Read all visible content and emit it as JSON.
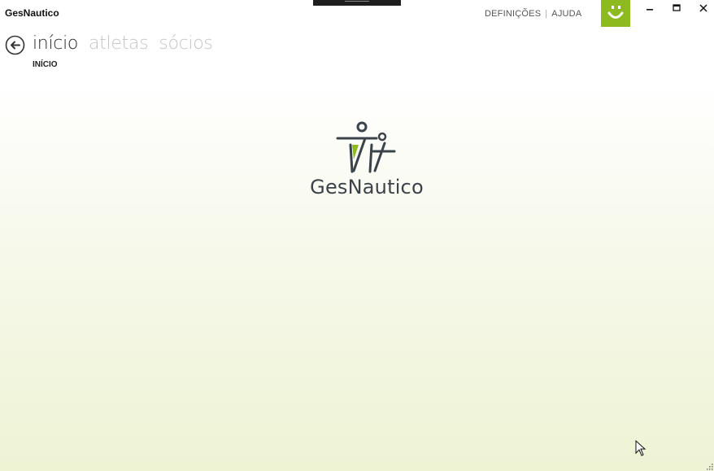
{
  "app": {
    "title": "GesNautico"
  },
  "header_links": {
    "settings": "DEFINIÇÕES",
    "separator": "|",
    "help": "AJUDA"
  },
  "navigation": {
    "tabs": [
      {
        "label": "início",
        "active": true
      },
      {
        "label": "atletas",
        "active": false
      },
      {
        "label": "sócios",
        "active": false
      }
    ],
    "subtitle": "INÍCIO"
  },
  "logo": {
    "text": "GesNautico"
  },
  "colors": {
    "accent_green": "#8dbb1f",
    "logo_dark": "#3b434a"
  },
  "icons": {
    "back": "back-arrow-circle-icon",
    "minimize": "minimize-icon",
    "maximize": "maximize-icon",
    "close": "close-icon",
    "user": "smiley-icon"
  }
}
